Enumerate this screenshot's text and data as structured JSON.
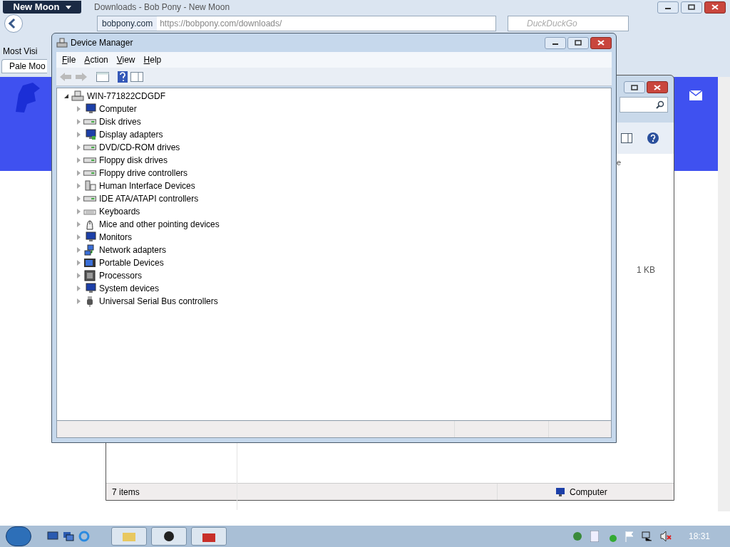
{
  "browser": {
    "menu_button": "New Moon",
    "title": "Downloads - Bob Pony - New Moon",
    "site_label": "bobpony.com",
    "url": "https://bobpony.com/downloads/",
    "search_placeholder": "DuckDuckGo",
    "bookmark": "Most Visi",
    "tab": "Pale Moo"
  },
  "explorer": {
    "column_fragment": "e",
    "file_size": "1 KB",
    "status": "7 items",
    "location": "Computer"
  },
  "device_manager": {
    "title": "Device Manager",
    "menu": [
      "File",
      "Action",
      "View",
      "Help"
    ],
    "root": {
      "label": "WIN-771822CDGDF",
      "expanded": true,
      "children": [
        {
          "label": "Computer",
          "kind": "computer",
          "expanded": false
        },
        {
          "label": "Disk drives",
          "kind": "drive",
          "expanded": false
        },
        {
          "label": "Display adapters",
          "kind": "display",
          "expanded": false
        },
        {
          "label": "DVD/CD-ROM drives",
          "kind": "drive",
          "expanded": false
        },
        {
          "label": "Floppy disk drives",
          "kind": "drive",
          "expanded": false
        },
        {
          "label": "Floppy drive controllers",
          "kind": "drive",
          "expanded": false
        },
        {
          "label": "Human Interface Devices",
          "kind": "hid",
          "expanded": false
        },
        {
          "label": "IDE ATA/ATAPI controllers",
          "kind": "drive",
          "expanded": false
        },
        {
          "label": "Keyboards",
          "kind": "keyboard",
          "expanded": false
        },
        {
          "label": "Mice and other pointing devices",
          "kind": "mouse",
          "expanded": false
        },
        {
          "label": "Monitors",
          "kind": "monitor",
          "expanded": false
        },
        {
          "label": "Network adapters",
          "kind": "network",
          "expanded": false
        },
        {
          "label": "Portable Devices",
          "kind": "portable",
          "expanded": false
        },
        {
          "label": "Processors",
          "kind": "chip",
          "expanded": false
        },
        {
          "label": "System devices",
          "kind": "computer",
          "expanded": false
        },
        {
          "label": "Universal Serial Bus controllers",
          "kind": "usb",
          "expanded": false
        }
      ]
    }
  },
  "taskbar": {
    "clock": "18:31"
  }
}
